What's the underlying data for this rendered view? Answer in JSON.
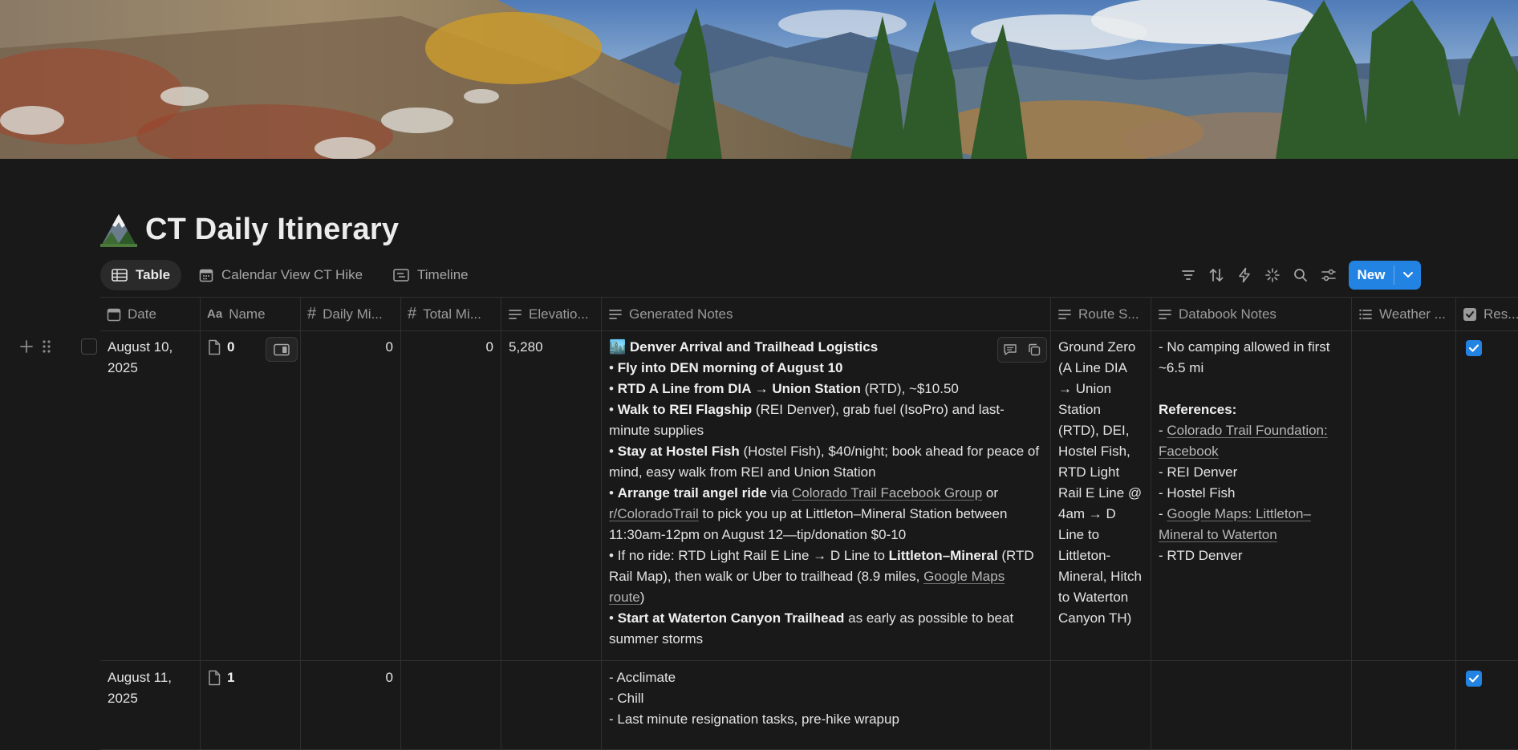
{
  "page": {
    "title": "CT Daily Itinerary",
    "icon": "mountain-icon"
  },
  "views": {
    "tabs": [
      {
        "label": "Table",
        "icon": "table-icon",
        "active": true
      },
      {
        "label": "Calendar View CT Hike",
        "icon": "calendar-icon",
        "active": false
      },
      {
        "label": "Timeline",
        "icon": "timeline-icon",
        "active": false
      }
    ],
    "tools": [
      "filter-icon",
      "sort-icon",
      "lightning-icon",
      "sparkle-icon",
      "search-icon",
      "settings-sliders-icon"
    ],
    "new_label": "New"
  },
  "colors": {
    "background": "#191919",
    "accent": "#2383e2",
    "border": "#2f2f2f"
  },
  "columns": [
    {
      "label": "Date",
      "icon": "calendar-icon"
    },
    {
      "label": "Name",
      "icon": "text-aa-icon"
    },
    {
      "label": "Daily Mi...",
      "icon": "hash-icon"
    },
    {
      "label": "Total Mi...",
      "icon": "hash-icon"
    },
    {
      "label": "Elevatio...",
      "icon": "text-lines-icon"
    },
    {
      "label": "Generated Notes",
      "icon": "text-lines-icon"
    },
    {
      "label": "Route S...",
      "icon": "text-lines-icon"
    },
    {
      "label": "Databook Notes",
      "icon": "text-lines-icon"
    },
    {
      "label": "Weather ...",
      "icon": "list-icon"
    },
    {
      "label": "Res...",
      "icon": "checkbox-icon"
    }
  ],
  "rows": [
    {
      "date": "August 10, 2025",
      "name": "0",
      "daily_miles": "0",
      "total_miles": "0",
      "elevation": "5,280",
      "generated_notes": {
        "emoji": "🏙️",
        "heading": "Denver Arrival and Trailhead Logistics",
        "l1_bold": "Fly into DEN morning of August 10",
        "l2_bold": "RTD A Line from DIA → Union Station",
        "l2_rest": " (RTD), ~$10.50",
        "l3_bold": "Walk to REI Flagship",
        "l3_rest": " (REI Denver), grab fuel (IsoPro) and last-minute supplies",
        "l4_bold": "Stay at Hostel Fish",
        "l4_rest": " (Hostel Fish), $40/night; book ahead for peace of mind, easy walk from REI and Union Station",
        "l5_bold": "Arrange trail angel ride",
        "l5_a": " via ",
        "l5_link1": "Colorado Trail Facebook Group",
        "l5_b": " or ",
        "l5_link2": "r/ColoradoTrail",
        "l5_c": " to pick you up at Littleton–Mineral Station between 11:30am-12pm on August 12—tip/donation $0-10",
        "l6_a": "If no ride: RTD Light Rail E Line → D Line to ",
        "l6_bold": "Littleton–Mineral",
        "l6_b": " (RTD Rail Map), then walk or Uber to trailhead (8.9 miles, ",
        "l6_link": "Google Maps route",
        "l6_c": ")",
        "l7_bold": "Start at Waterton Canyon Trailhead",
        "l7_rest": " as early as possible to beat summer storms"
      },
      "route": "Ground Zero (A Line DIA → Union Station (RTD), DEI, Hostel Fish, RTD Light Rail E Line @ 4am → D Line to Littleton-Mineral, Hitch to Waterton Canyon TH)",
      "databook": {
        "l1": "- No camping allowed in first ~6.5 mi",
        "refs": "References:",
        "dash": "- ",
        "link1": "Colorado Trail Foundation: Facebook",
        "l2": "- REI Denver",
        "l3": "- Hostel Fish",
        "link2": "Google Maps: Littleton–Mineral to Waterton",
        "l4": "- RTD Denver"
      },
      "weather": "",
      "reserved": true
    },
    {
      "date": "August 11, 2025",
      "name": "1",
      "daily_miles": "0",
      "total_miles": "",
      "elevation": "",
      "generated_notes_lines": [
        "- Acclimate",
        "- Chill",
        "- Last minute resignation tasks, pre-hike wrapup"
      ],
      "route": "",
      "databook_text": "",
      "weather": "",
      "reserved": true
    }
  ]
}
